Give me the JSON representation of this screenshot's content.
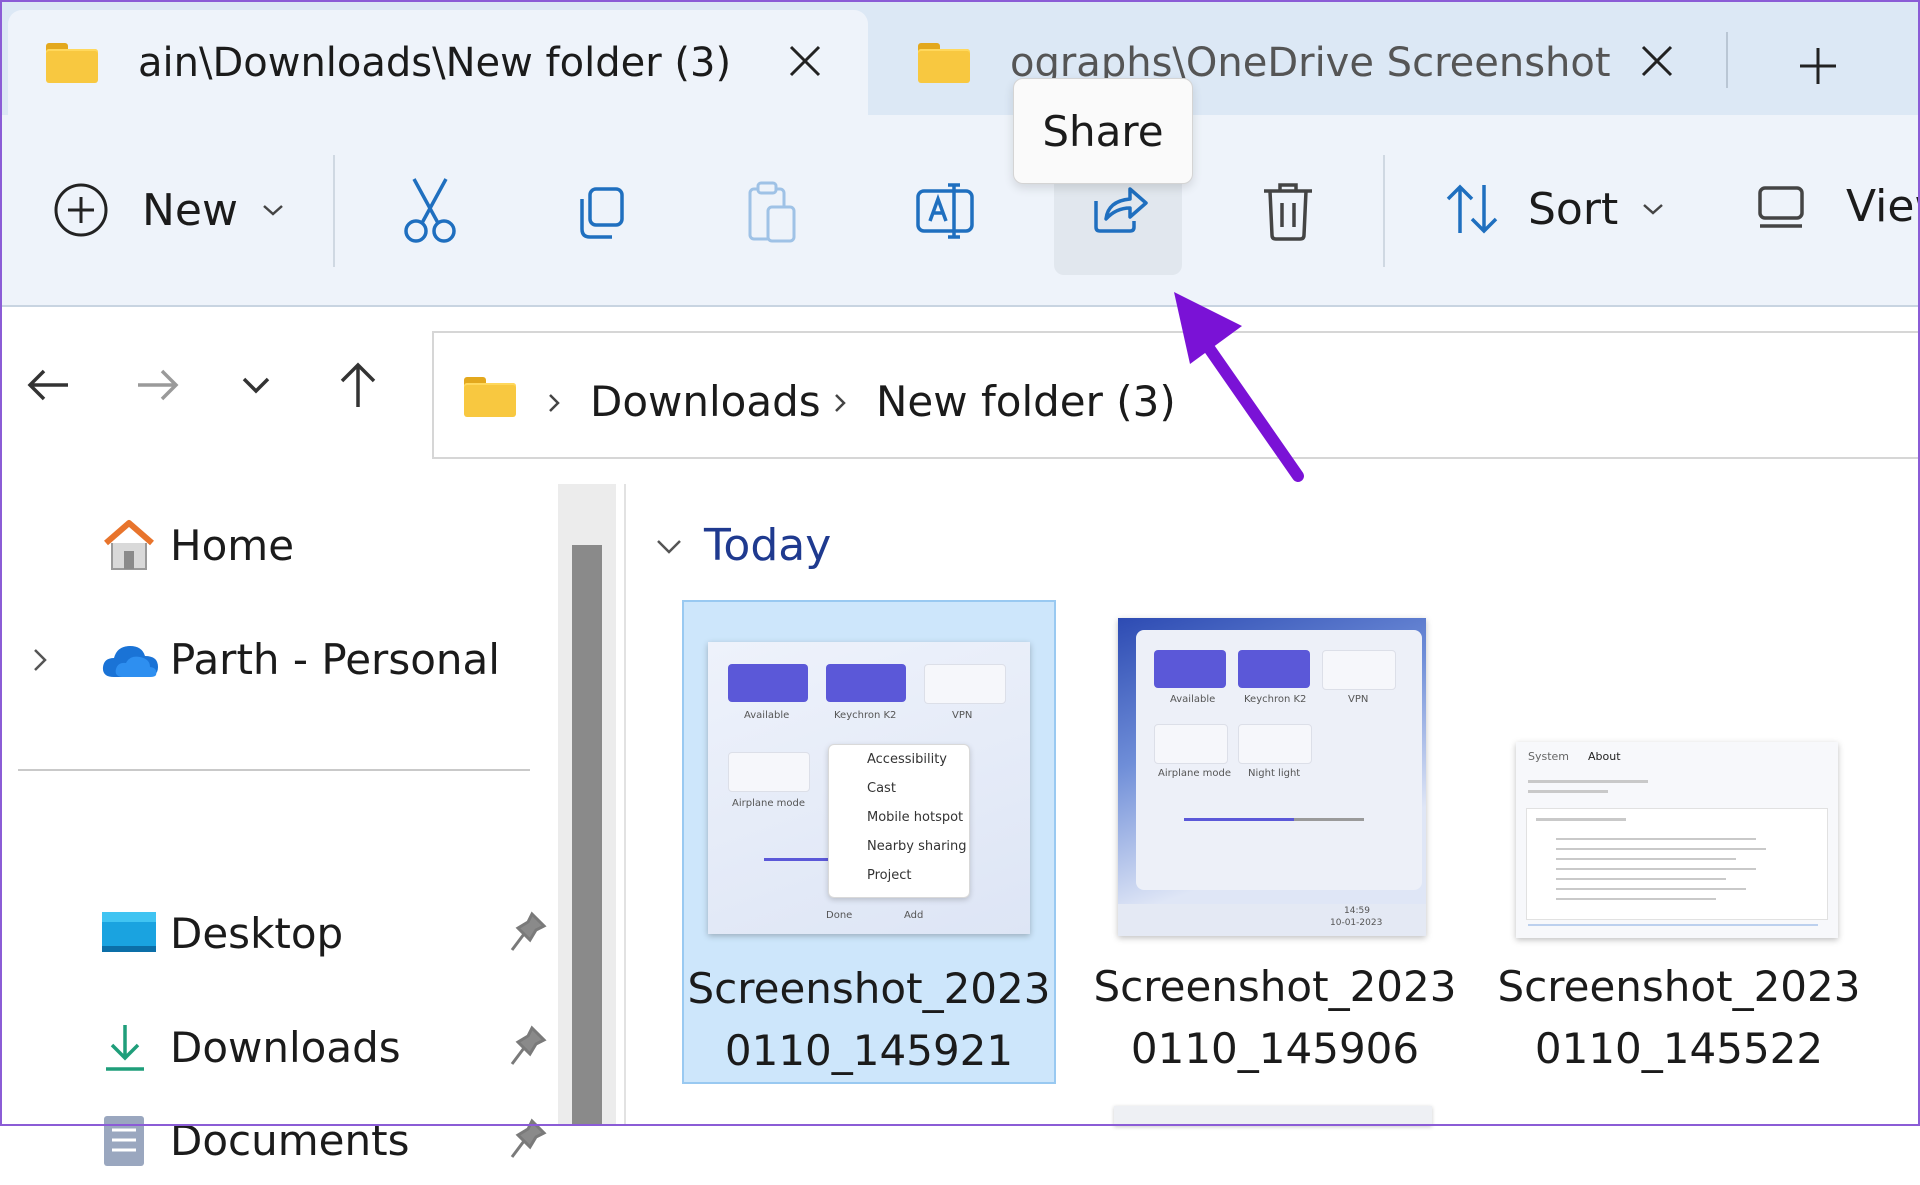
{
  "tabs": [
    {
      "title": "ain\\Downloads\\New folder (3)",
      "active": true
    },
    {
      "title": "ographs\\OneDrive Screenshots",
      "active": false
    }
  ],
  "toolbar": {
    "new_label": "New",
    "sort_label": "Sort",
    "view_label": "View",
    "tooltip": "Share"
  },
  "address": {
    "crumbs": [
      "Downloads",
      "New folder (3)"
    ]
  },
  "sidebar": {
    "items": [
      {
        "label": "Home"
      },
      {
        "label": "Parth - Personal"
      },
      {
        "label": "Desktop"
      },
      {
        "label": "Downloads"
      },
      {
        "label": "Documents"
      }
    ]
  },
  "content": {
    "group": "Today",
    "files": [
      {
        "name_line1": "Screenshot_2023",
        "name_line2": "0110_145921",
        "selected": true
      },
      {
        "name_line1": "Screenshot_2023",
        "name_line2": "0110_145906",
        "selected": false
      },
      {
        "name_line1": "Screenshot_2023",
        "name_line2": "0110_145522",
        "selected": false
      }
    ]
  },
  "thumb1": {
    "caps": [
      "Available",
      "Keychron K2",
      "VPN",
      "Airplane mode"
    ],
    "menu": [
      "Accessibility",
      "Cast",
      "Mobile hotspot",
      "Nearby sharing",
      "Project"
    ],
    "done": "Done",
    "add": "Add"
  },
  "thumb2": {
    "caps": [
      "Available",
      "Keychron K2",
      "VPN",
      "Airplane mode",
      "Night light"
    ],
    "time": "14:59",
    "date": "10-01-2023"
  },
  "thumb3": {
    "crumb_system": "System",
    "crumb_about": "About"
  },
  "colors": {
    "annotation_arrow": "#7a12d6",
    "accent": "#5b58d8",
    "selection": "#cde6fb"
  }
}
